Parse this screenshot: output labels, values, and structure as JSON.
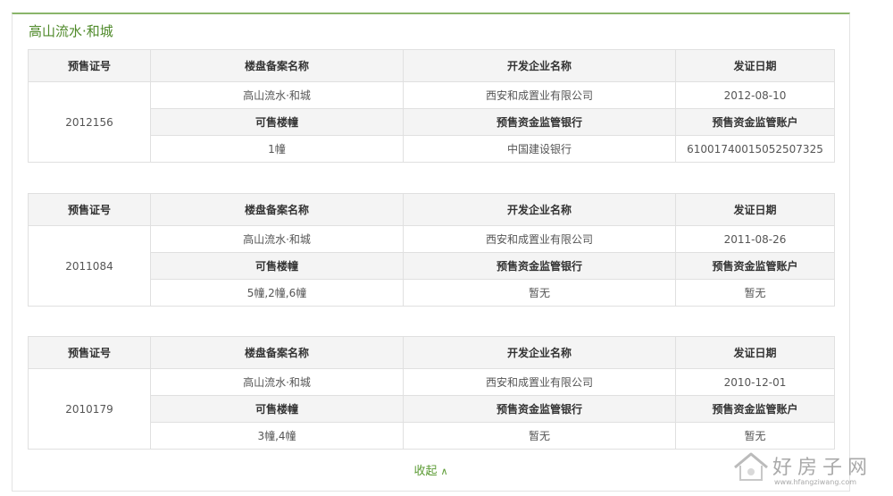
{
  "title": "高山流水·和城",
  "headers": {
    "permit_no": "预售证号",
    "project_name": "楼盘备案名称",
    "developer": "开发企业名称",
    "issue_date": "发证日期",
    "buildings": "可售楼幢",
    "bank": "预售资金监管银行",
    "account": "预售资金监管账户"
  },
  "permits": [
    {
      "permit_no": "2012156",
      "project_name": "高山流水·和城",
      "developer": "西安和成置业有限公司",
      "issue_date": "2012-08-10",
      "buildings": "1幢",
      "bank": "中国建设银行",
      "account": "61001740015052507325"
    },
    {
      "permit_no": "2011084",
      "project_name": "高山流水·和城",
      "developer": "西安和成置业有限公司",
      "issue_date": "2011-08-26",
      "buildings": "5幢,2幢,6幢",
      "bank": "暂无",
      "account": "暂无"
    },
    {
      "permit_no": "2010179",
      "project_name": "高山流水·和城",
      "developer": "西安和成置业有限公司",
      "issue_date": "2010-12-01",
      "buildings": "3幢,4幢",
      "bank": "暂无",
      "account": "暂无"
    }
  ],
  "collapse_label": "收起",
  "watermark": {
    "text": "好房子网",
    "url": "www.hfangziwang.com"
  }
}
